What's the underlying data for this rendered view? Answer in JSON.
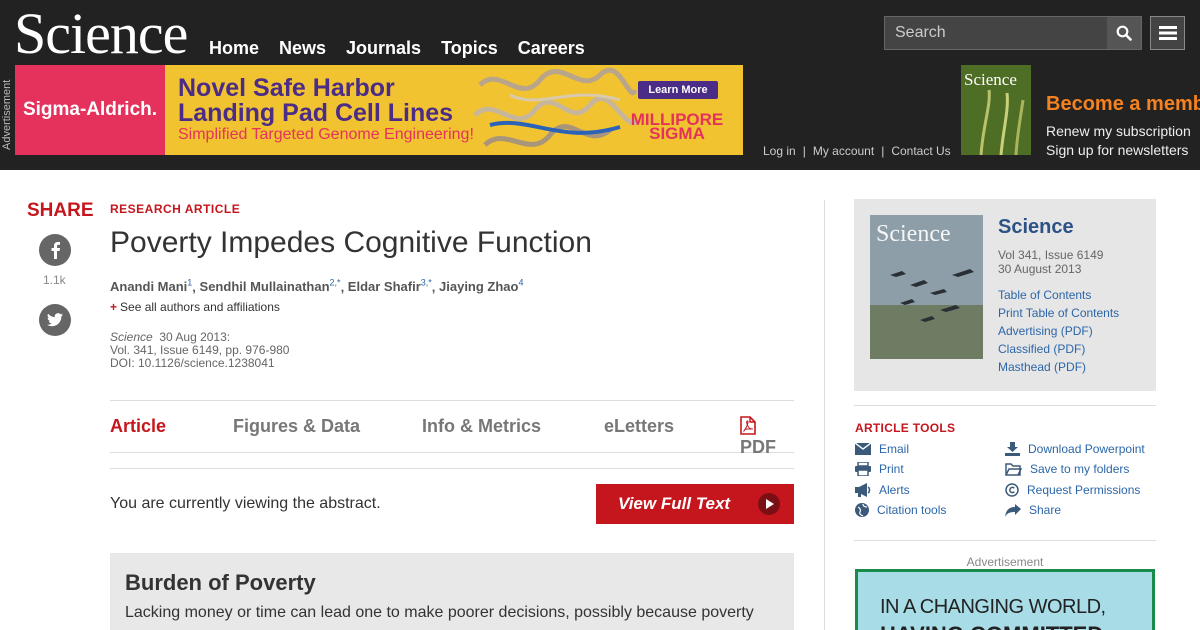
{
  "header": {
    "logo": "Science",
    "nav": [
      "Home",
      "News",
      "Journals",
      "Topics",
      "Careers"
    ],
    "search_placeholder": "Search",
    "advertisement_label": "Advertisement",
    "user_links": [
      "Log in",
      "My account",
      "Contact Us"
    ],
    "become_member": "Become a member",
    "renew": "Renew my subscription",
    "newsletters": "Sign up for newsletters"
  },
  "banner_ad": {
    "brand": "Sigma-Aldrich.",
    "headline_line1": "Novel Safe Harbor",
    "headline_line2": "Landing Pad Cell Lines",
    "subline": "Simplified Targeted Genome Engineering!",
    "button": "Learn More",
    "logo_line1": "MILLIPORE",
    "logo_line2": "SIGMA"
  },
  "share": {
    "title": "SHARE",
    "facebook_count": "1.1k"
  },
  "article": {
    "kicker": "RESEARCH ARTICLE",
    "title": "Poverty Impedes Cognitive Function",
    "authors": [
      {
        "name": "Anandi Mani",
        "sup": "1"
      },
      {
        "name": "Sendhil Mullainathan",
        "sup": "2,*"
      },
      {
        "name": "Eldar Shafir",
        "sup": "3,*"
      },
      {
        "name": "Jiaying Zhao",
        "sup": "4"
      }
    ],
    "see_all": "See all authors and affiliations",
    "journal": "Science",
    "date": "30 Aug 2013:",
    "volume": "Vol. 341, Issue 6149, pp. 976-980",
    "doi": "DOI: 10.1126/science.1238041"
  },
  "tabs": [
    "Article",
    "Figures & Data",
    "Info & Metrics",
    "eLetters",
    "PDF"
  ],
  "abstract": {
    "viewing": "You are currently viewing the abstract.",
    "full_text_button": "View Full Text",
    "editor_title": "Burden of Poverty",
    "editor_text": "Lacking money or time can lead one to make poorer decisions, possibly because poverty"
  },
  "issue": {
    "journal": "Science",
    "volume": "Vol 341, Issue 6149",
    "date": "30 August 2013",
    "links": [
      "Table of Contents",
      "Print Table of Contents",
      "Advertising (PDF)",
      "Classified (PDF)",
      "Masthead (PDF)"
    ]
  },
  "article_tools": {
    "title": "ARTICLE TOOLS",
    "left": [
      "Email",
      "Print",
      "Alerts",
      "Citation tools"
    ],
    "right": [
      "Download Powerpoint",
      "Save to my folders",
      "Request Permissions",
      "Share"
    ]
  },
  "side_ad": {
    "label": "Advertisement",
    "line1": "IN A CHANGING WORLD,",
    "line2": "HAVING COMMITTED"
  },
  "colors": {
    "science_red": "#c4161c",
    "link_blue": "#2c66a8",
    "header_bg": "#222222",
    "member_orange": "#f58220"
  }
}
